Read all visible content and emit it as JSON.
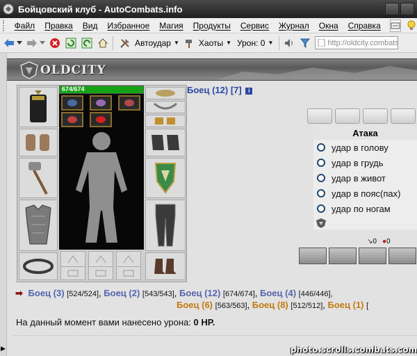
{
  "window": {
    "title": "Бойцовский клуб - AutoCombats.info"
  },
  "menu": {
    "items": [
      "Файл",
      "Правка",
      "Вид",
      "Избранное",
      "Магия",
      "Продукты",
      "Сервис",
      "Журнал",
      "Окна",
      "Справка"
    ]
  },
  "toolbar": {
    "autoudar_label": "Автоудар",
    "haoty_label": "Хаоты",
    "damage_label": "Урон: 0",
    "url": "http://oldcity.combats.com"
  },
  "site": {
    "logo_text": "OLDCITY"
  },
  "character": {
    "hp_text": "674/674",
    "hp_fraction": 1.0
  },
  "fighter": {
    "name": "Боец (12) [7]",
    "info_icon": "i"
  },
  "attack": {
    "title": "Атака",
    "options": [
      "удар в голову",
      "удар в грудь",
      "удар в живот",
      "удар в пояс(пах)",
      "удар по ногам"
    ]
  },
  "counters": {
    "a": "0",
    "b": "0"
  },
  "fighters_list": {
    "row1": [
      {
        "name": "Боец (3)",
        "hp": "[524/524]",
        "team": "blue"
      },
      {
        "name": "Боец (2)",
        "hp": "[543/543]",
        "team": "blue"
      },
      {
        "name": "Боец (12)",
        "hp": "[674/674]",
        "team": "blue"
      },
      {
        "name": "Боец (4)",
        "hp": "[446/446],",
        "team": "blue"
      }
    ],
    "row2": [
      {
        "name": "Боец (6)",
        "hp": "[563/563]",
        "team": "orange"
      },
      {
        "name": "Боец (8)",
        "hp": "[512/512]",
        "team": "orange"
      },
      {
        "name": "Боец (1)",
        "hp": "[",
        "team": "orange"
      }
    ]
  },
  "damage": {
    "text": "На данный момент вами нанесено урона: ",
    "value": "0 HP."
  },
  "watermark": "photo.scrolls.combats.com"
}
